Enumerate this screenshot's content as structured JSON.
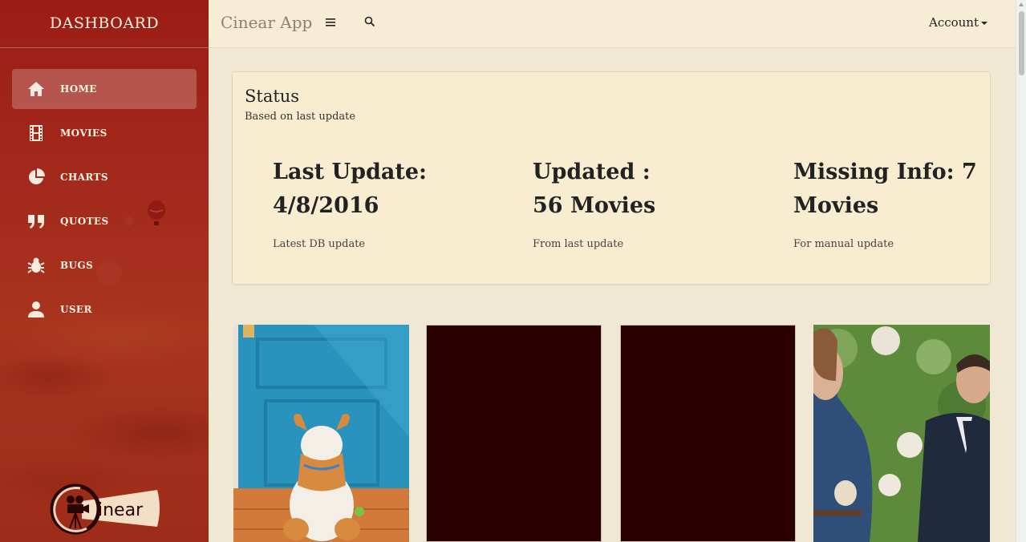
{
  "sidebar": {
    "title": "DASHBOARD",
    "items": [
      {
        "label": "HOME",
        "icon": "home-icon",
        "active": true
      },
      {
        "label": "MOVIES",
        "icon": "film-icon",
        "active": false
      },
      {
        "label": "CHARTS",
        "icon": "pie-chart-icon",
        "active": false
      },
      {
        "label": "QUOTES",
        "icon": "quote-icon",
        "active": false
      },
      {
        "label": "BUGS",
        "icon": "bug-icon",
        "active": false
      },
      {
        "label": "USER",
        "icon": "user-icon",
        "active": false
      }
    ],
    "logo_text": "inear"
  },
  "topbar": {
    "brand": "Cinear App",
    "menu_icon": "hamburger-menu-icon",
    "search_icon": "search-icon",
    "account_label": "Account"
  },
  "status": {
    "title": "Status",
    "subtitle": "Based on last update",
    "stats": [
      {
        "line1": "Last Update:",
        "line2": "4/8/2016",
        "note": "Latest DB update"
      },
      {
        "line1": "Updated :",
        "line2": "56 Movies",
        "note": "From last update"
      },
      {
        "line1": "Missing Info: 7",
        "line2": "Movies",
        "note": "For manual update"
      }
    ]
  },
  "colors": {
    "sidebar": "#9b1c16",
    "page_bg": "#f1e8d3",
    "card_bg": "#f9edd1",
    "topbar_bg": "#f7edd4",
    "poster_blank": "#2a0000"
  }
}
